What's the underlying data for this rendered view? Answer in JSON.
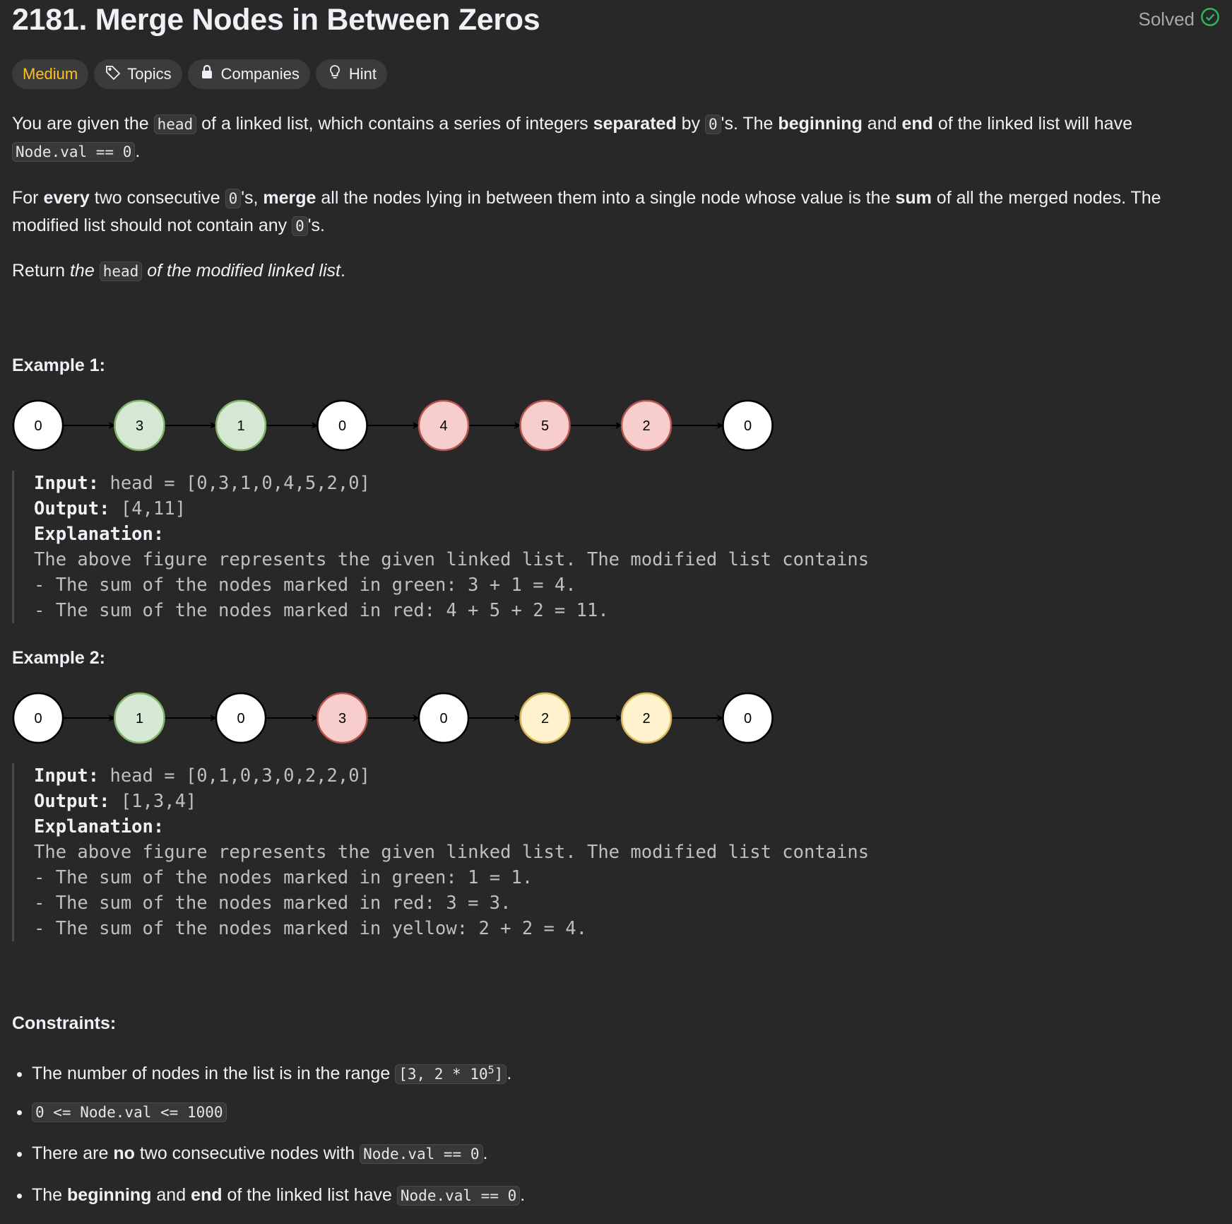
{
  "problem": {
    "title": "2181. Merge Nodes in Between Zeros",
    "status": "Solved",
    "tags": {
      "difficulty": "Medium",
      "topics": "Topics",
      "companies": "Companies",
      "hint": "Hint"
    }
  },
  "description": {
    "p1_a": "You are given the ",
    "p1_head": "head",
    "p1_b": " of a linked list, which contains a series of integers ",
    "p1_sep": "separated",
    "p1_c": " by ",
    "p1_zero": "0",
    "p1_d": "'s. The ",
    "p1_beg": "beginning",
    "p1_e": " and ",
    "p1_end": "end",
    "p1_f": " of the linked list will have ",
    "p1_code": "Node.val == 0",
    "p1_g": ".",
    "p2_a": "For ",
    "p2_every": "every",
    "p2_b": " two consecutive ",
    "p2_zero": "0",
    "p2_c": "'s, ",
    "p2_merge": "merge",
    "p2_d": " all the nodes lying in between them into a single node whose value is the ",
    "p2_sum": "sum",
    "p2_e": " of all the merged nodes. The modified list should not contain any ",
    "p2_zero2": "0",
    "p2_f": "'s.",
    "p3_a": "Return ",
    "p3_the": "the ",
    "p3_head": "head",
    "p3_b": " of the modified linked list",
    "p3_c": "."
  },
  "examples": [
    {
      "heading": "Example 1:",
      "nodes": [
        {
          "v": "0",
          "c": "white"
        },
        {
          "v": "3",
          "c": "green"
        },
        {
          "v": "1",
          "c": "green"
        },
        {
          "v": "0",
          "c": "white"
        },
        {
          "v": "4",
          "c": "red"
        },
        {
          "v": "5",
          "c": "red"
        },
        {
          "v": "2",
          "c": "red"
        },
        {
          "v": "0",
          "c": "white"
        }
      ],
      "input_label": "Input:",
      "input": " head = [0,3,1,0,4,5,2,0]",
      "output_label": "Output:",
      "output": " [4,11]",
      "explanation_label": "Explanation:",
      "lines": [
        "The above figure represents the given linked list. The modified list contains",
        "- The sum of the nodes marked in green: 3 + 1 = 4.",
        "- The sum of the nodes marked in red: 4 + 5 + 2 = 11."
      ]
    },
    {
      "heading": "Example 2:",
      "nodes": [
        {
          "v": "0",
          "c": "white"
        },
        {
          "v": "1",
          "c": "green"
        },
        {
          "v": "0",
          "c": "white"
        },
        {
          "v": "3",
          "c": "red"
        },
        {
          "v": "0",
          "c": "white"
        },
        {
          "v": "2",
          "c": "yellow"
        },
        {
          "v": "2",
          "c": "yellow"
        },
        {
          "v": "0",
          "c": "white"
        }
      ],
      "input_label": "Input:",
      "input": " head = [0,1,0,3,0,2,2,0]",
      "output_label": "Output:",
      "output": " [1,3,4]",
      "explanation_label": "Explanation:",
      "lines": [
        "The above figure represents the given linked list. The modified list contains",
        "- The sum of the nodes marked in green: 1 = 1.",
        "- The sum of the nodes marked in red: 3 = 3.",
        "- The sum of the nodes marked in yellow: 2 + 2 = 4."
      ]
    }
  ],
  "node_colors": {
    "white": {
      "fill": "#ffffff",
      "stroke": "#000000"
    },
    "green": {
      "fill": "#d5e8d4",
      "stroke": "#82b366"
    },
    "red": {
      "fill": "#f8cecc",
      "stroke": "#b85450"
    },
    "yellow": {
      "fill": "#fff2cc",
      "stroke": "#d6b656"
    }
  },
  "constraints": {
    "heading": "Constraints:",
    "c1_a": "The number of nodes in the list is in the range ",
    "c1_code": "[3, 2 * 10",
    "c1_sup": "5",
    "c1_code_end": "]",
    "c1_b": ".",
    "c2_code": "0 <= Node.val <= 1000",
    "c3_a": "There are ",
    "c3_no": "no",
    "c3_b": " two consecutive nodes with ",
    "c3_code": "Node.val == 0",
    "c3_c": ".",
    "c4_a": "The ",
    "c4_beg": "beginning",
    "c4_b": " and ",
    "c4_end": "end",
    "c4_c": " of the linked list have ",
    "c4_code": "Node.val == 0",
    "c4_d": "."
  },
  "accent_colors": {
    "medium": "#ffc01e",
    "solved_check": "#2cbb5d"
  }
}
